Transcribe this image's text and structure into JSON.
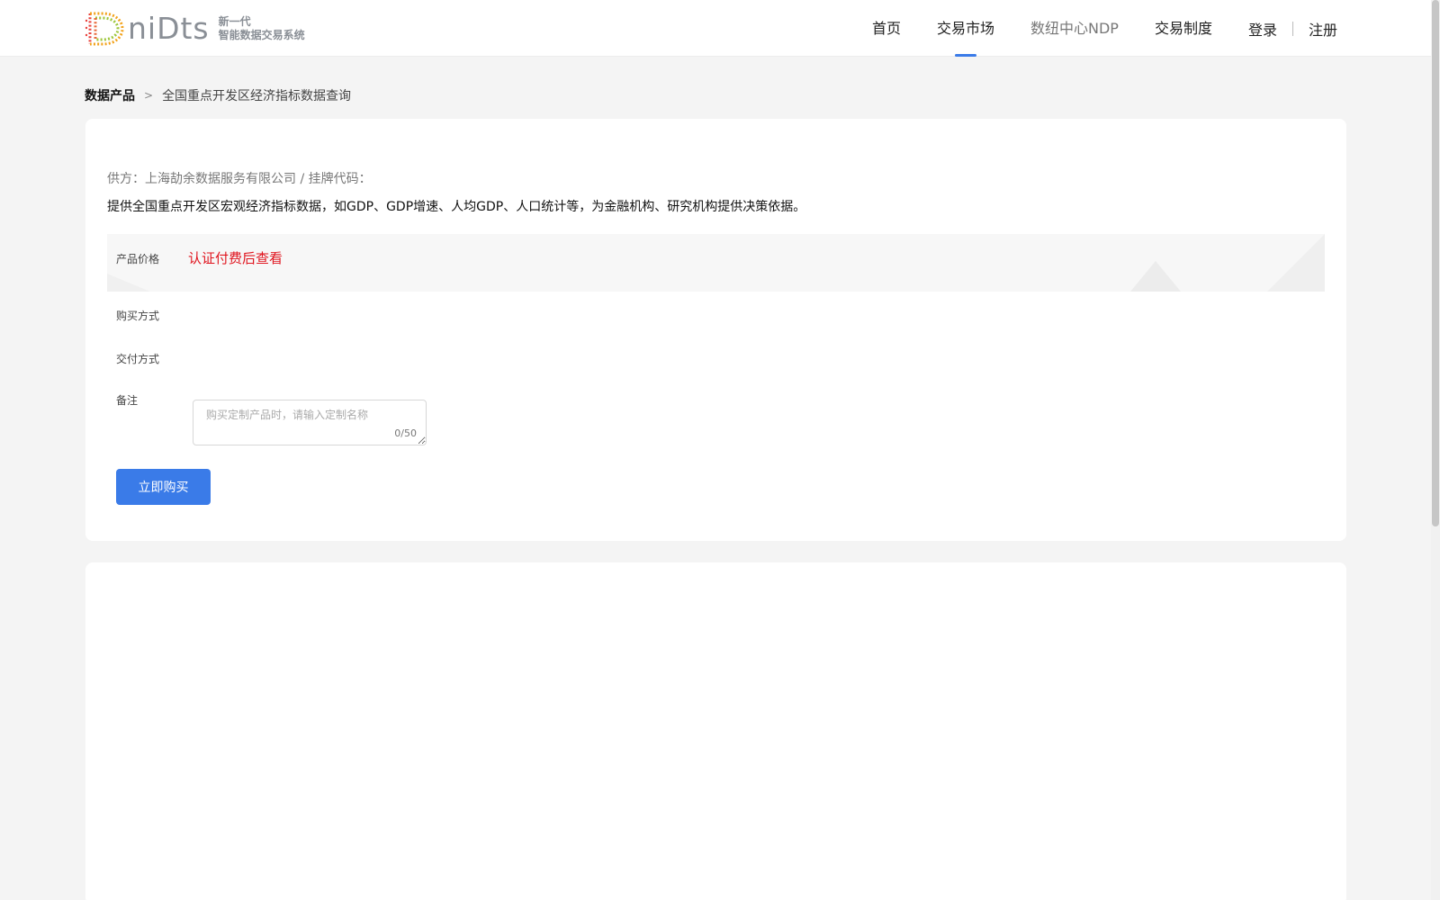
{
  "header": {
    "logo": {
      "wordmark": "niDts",
      "tagline_1": "新一代",
      "tagline_2": "智能数据交易系统"
    },
    "nav": [
      {
        "label": "首页",
        "active": false
      },
      {
        "label": "交易市场",
        "active": true
      },
      {
        "label": "数纽中心NDP",
        "active": false
      },
      {
        "label": "交易制度",
        "active": false
      }
    ],
    "auth": {
      "login": "登录",
      "register": "注册"
    }
  },
  "breadcrumb": {
    "root": "数据产品",
    "current": "全国重点开发区经济指标数据查询"
  },
  "product": {
    "supplier_line": "供方：上海劼余数据服务有限公司 / 挂牌代码：",
    "description": "提供全国重点开发区宏观经济指标数据，如GDP、GDP增速、人均GDP、人口统计等，为金融机构、研究机构提供决策依据。",
    "price_label": "产品价格",
    "price_value": "认证付费后查看",
    "purchase_method_label": "购买方式",
    "delivery_method_label": "交付方式",
    "remark_label": "备注",
    "remark_placeholder": "购买定制产品时，请输入定制名称",
    "remark_counter": "0/50",
    "buy_button": "立即购买"
  },
  "colors": {
    "accent": "#3a7be8",
    "price_red": "#e0141e",
    "page_bg": "#f4f4f4"
  }
}
